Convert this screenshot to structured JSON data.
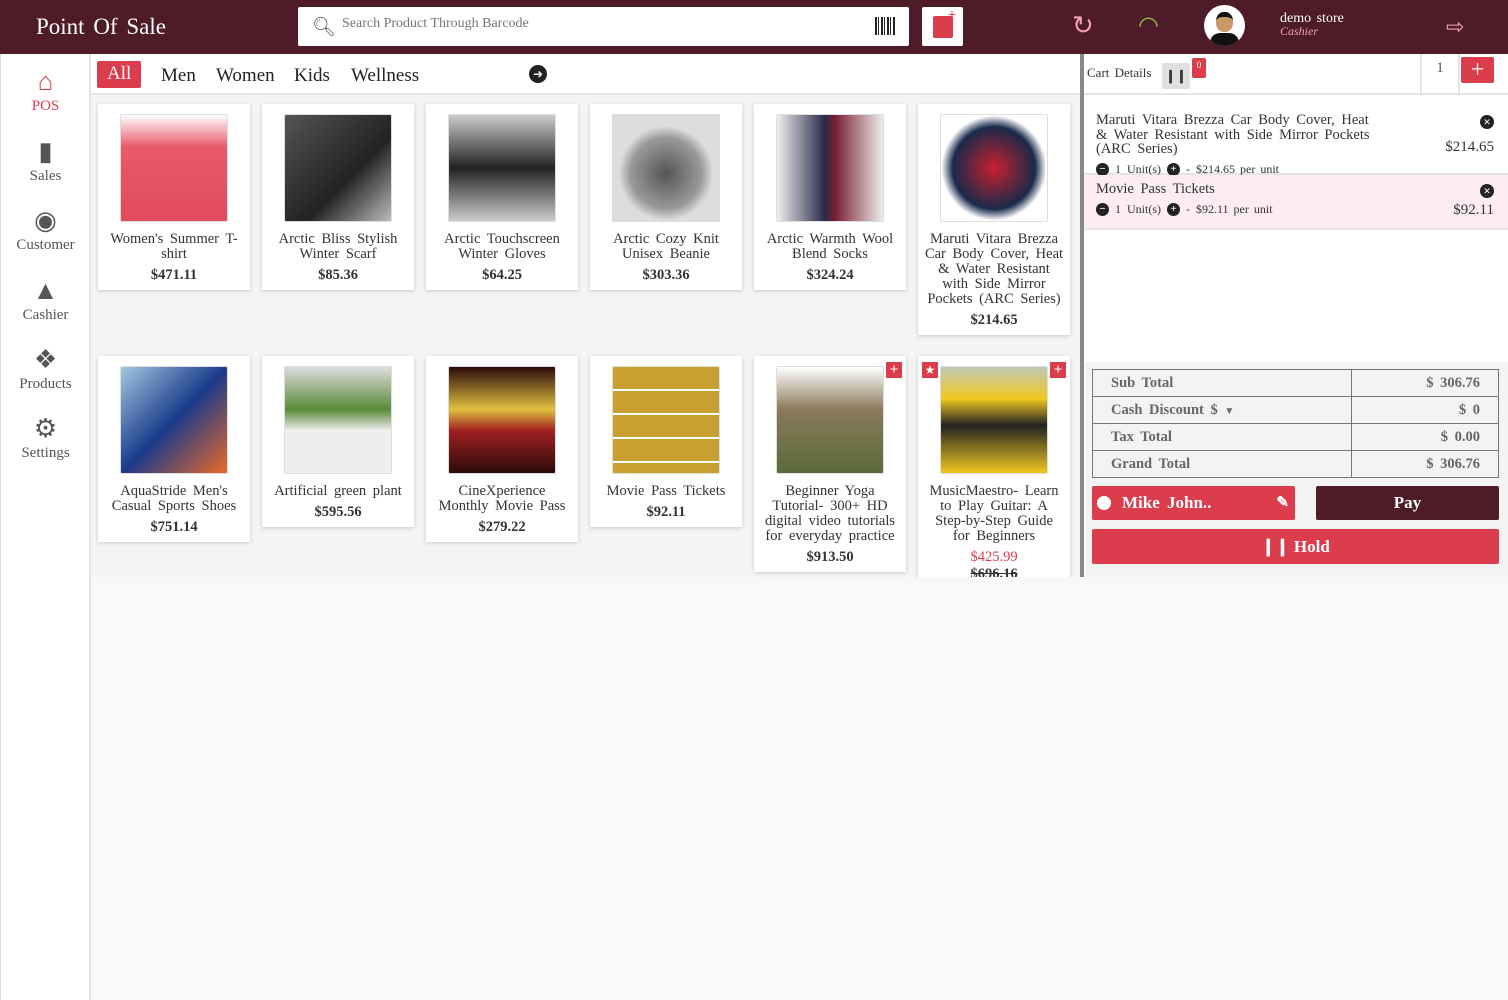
{
  "header": {
    "title": "Point Of Sale",
    "search_placeholder": "Search Product Through Barcode",
    "user_name": "demo store",
    "user_role": "Cashier"
  },
  "colors": {
    "brand": "#4e1b28",
    "accent": "#dc3d4c",
    "wifi": "#8bc34a",
    "sync": "#f0a3b0"
  },
  "sidebar": {
    "items": [
      {
        "label": "POS",
        "icon": "home-icon",
        "active": true
      },
      {
        "label": "Sales",
        "icon": "file-icon"
      },
      {
        "label": "Customer",
        "icon": "user-circle-icon"
      },
      {
        "label": "Cashier",
        "icon": "user-icon"
      },
      {
        "label": "Products",
        "icon": "cubes-icon"
      },
      {
        "label": "Settings",
        "icon": "gear-icon"
      }
    ]
  },
  "categories": [
    "All",
    "Men",
    "Women",
    "Kids",
    "Wellness"
  ],
  "products": [
    {
      "name": "Women's Summer T-shirt",
      "price": "$471.11"
    },
    {
      "name": "Arctic Bliss Stylish Winter Scarf",
      "price": "$85.36"
    },
    {
      "name": "Arctic Touchscreen Winter Gloves",
      "price": "$64.25"
    },
    {
      "name": "Arctic Cozy Knit Unisex Beanie",
      "price": "$303.36"
    },
    {
      "name": "Arctic Warmth Wool Blend Socks",
      "price": "$324.24"
    },
    {
      "name": "Maruti Vitara Brezza Car Body Cover, Heat & Water Resistant with Side Mirror Pockets (ARC Series)",
      "price": "$214.65"
    },
    {
      "name": "AquaStride Men's Casual Sports Shoes",
      "price": "$751.14"
    },
    {
      "name": "Artificial green plant",
      "price": "$595.56"
    },
    {
      "name": "CineXperience Monthly Movie Pass",
      "price": "$279.22"
    },
    {
      "name": "Movie Pass Tickets",
      "price": "$92.11"
    },
    {
      "name": "Beginner Yoga Tutorial- 300+ HD digital video tutorials for everyday practice",
      "price": "$913.50"
    },
    {
      "name": "MusicMaestro- Learn to Play Guitar: A Step-by-Step Guide for Beginners",
      "price": "$425.99",
      "old_price": "$696.16"
    }
  ],
  "cart": {
    "label": "Cart Details",
    "hold_count": "0",
    "cart_number": "1",
    "items": [
      {
        "name": "Maruti Vitara Brezza Car Body Cover, Heat & Water Resistant with Side Mirror Pockets (ARC Series)",
        "qty": "1",
        "unit_label": "Unit(s)",
        "per_unit": "$214.65 per unit",
        "total": "$214.65"
      },
      {
        "name": "Movie Pass Tickets",
        "qty": "1",
        "unit_label": "Unit(s)",
        "per_unit": "$92.11 per unit",
        "total": "$92.11"
      }
    ]
  },
  "totals": {
    "sub_total_label": "Sub Total",
    "sub_total": "$ 306.76",
    "discount_label": "Cash Discount $",
    "discount": "$ 0",
    "tax_label": "Tax Total",
    "tax": "$ 0.00",
    "grand_label": "Grand Total",
    "grand": "$ 306.76"
  },
  "actions": {
    "customer": "Mike John..",
    "pay": "Pay",
    "hold": "Hold"
  }
}
